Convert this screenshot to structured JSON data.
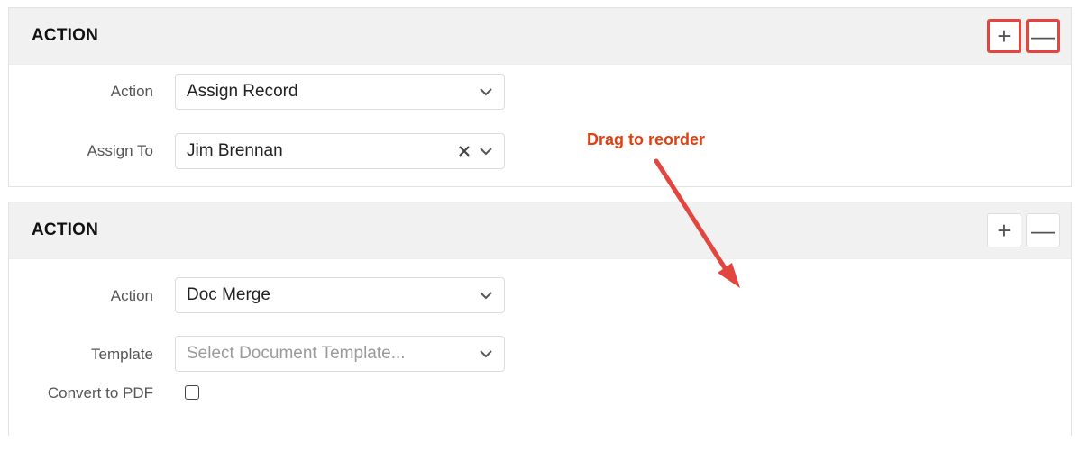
{
  "panels": [
    {
      "title": "ACTION",
      "add_button": "+",
      "remove_button": "—",
      "fields": {
        "action": {
          "label": "Action",
          "value": "Assign Record"
        },
        "assign_to": {
          "label": "Assign To",
          "value": "Jim Brennan"
        }
      }
    },
    {
      "title": "ACTION",
      "add_button": "+",
      "remove_button": "—",
      "fields": {
        "action": {
          "label": "Action",
          "value": "Doc Merge"
        },
        "template": {
          "label": "Template",
          "placeholder": "Select Document Template..."
        },
        "convert_to_pdf": {
          "label": "Convert to PDF",
          "checked": false
        }
      }
    }
  ],
  "annotation": {
    "text": "Drag to reorder",
    "color": "#e2400f"
  },
  "highlight_color": "#e2463f"
}
